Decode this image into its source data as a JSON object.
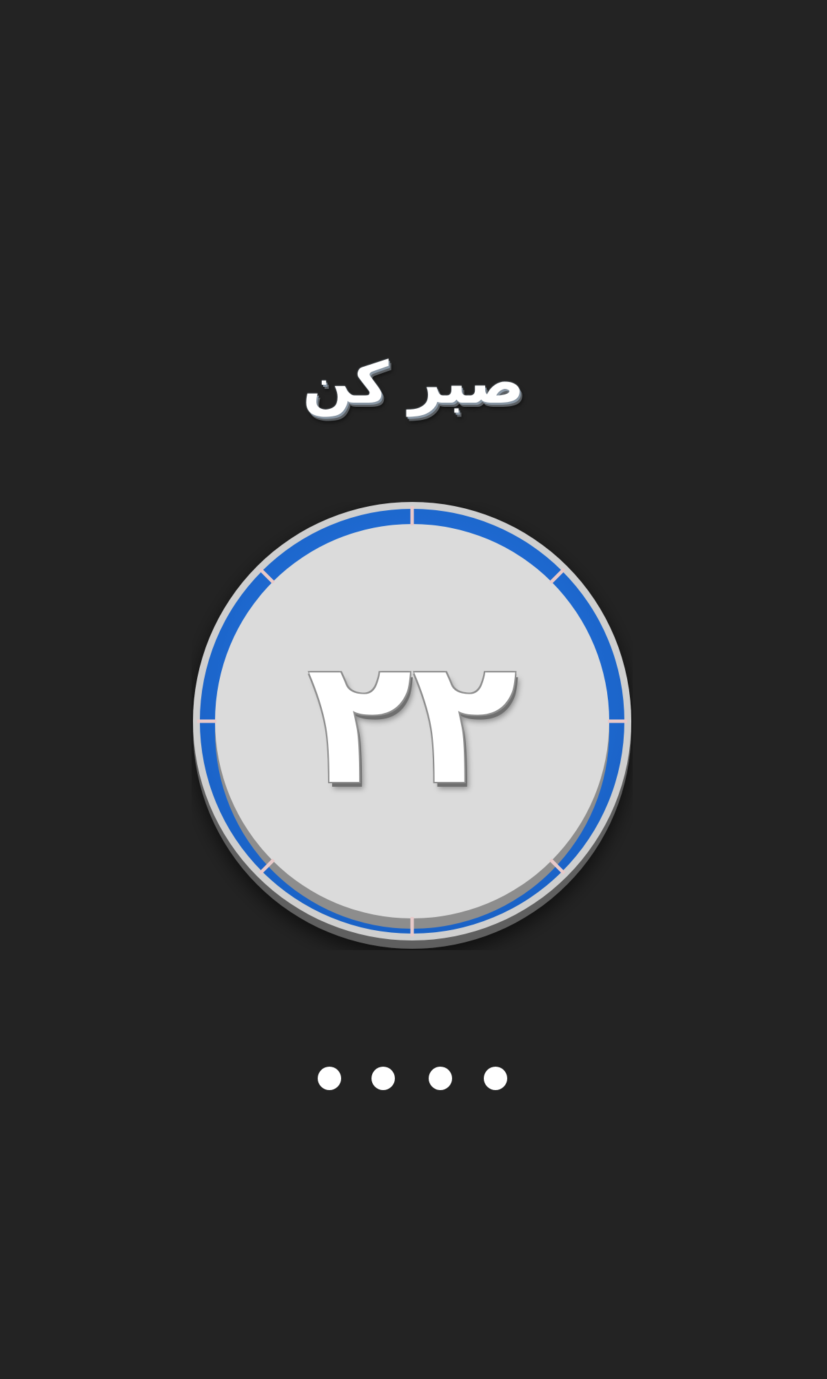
{
  "title": "صبر کن",
  "timer": {
    "value": "۲۲",
    "segments": 8,
    "ring_color": "#1e6fd9",
    "face_color": "#dbdbdb",
    "divider_color": "#e8c9c9"
  },
  "loading_dots": {
    "count": 4,
    "color": "#ffffff"
  },
  "colors": {
    "background": "#232323"
  }
}
